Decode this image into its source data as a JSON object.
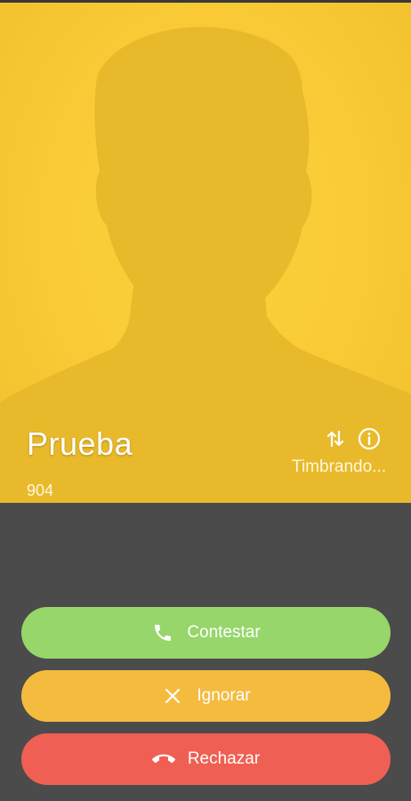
{
  "caller": {
    "name": "Prueba",
    "number": "904",
    "status": "Timbrando..."
  },
  "icons": {
    "swap": "swap-arrows-icon",
    "info": "info-icon",
    "answer": "phone-icon",
    "ignore": "close-icon",
    "reject": "hang-up-icon"
  },
  "actions": {
    "answer_label": "Contestar",
    "ignore_label": "Ignorar",
    "reject_label": "Rechazar"
  },
  "colors": {
    "hero_background": "#f9ca35",
    "silhouette": "#e8b92a",
    "bottom_background": "#4b4b4b",
    "answer": "#96d66b",
    "ignore": "#f4bb3f",
    "reject": "#ef5f53"
  }
}
